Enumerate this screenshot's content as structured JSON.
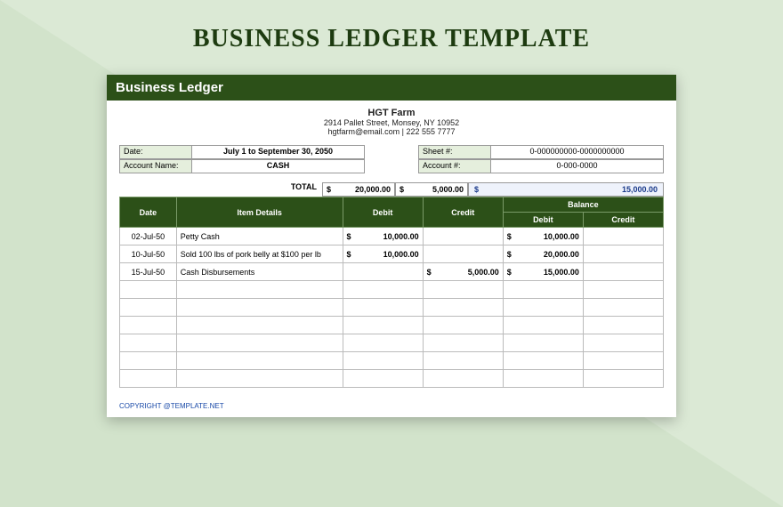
{
  "page_title": "BUSINESS LEDGER TEMPLATE",
  "doc_title": "Business Ledger",
  "org": {
    "name": "HGT Farm",
    "address": "2914 Pallet Street, Monsey, NY 10952",
    "contact": "hgtfarm@email.com | 222 555 7777"
  },
  "meta": {
    "date_label": "Date:",
    "date_value": "July 1 to September 30, 2050",
    "account_name_label": "Account Name:",
    "account_name_value": "CASH",
    "sheet_label": "Sheet #:",
    "sheet_value": "0-000000000-0000000000",
    "account_no_label": "Account #:",
    "account_no_value": "0-000-0000"
  },
  "totals": {
    "label": "TOTAL",
    "debit": "20,000.00",
    "credit": "5,000.00",
    "balance": "15,000.00",
    "currency": "$"
  },
  "headers": {
    "date": "Date",
    "item": "Item Details",
    "debit": "Debit",
    "credit": "Credit",
    "balance": "Balance",
    "bal_debit": "Debit",
    "bal_credit": "Credit"
  },
  "rows": [
    {
      "date": "02-Jul-50",
      "item": "Petty Cash",
      "debit": "10,000.00",
      "credit": "",
      "bal_debit": "10,000.00",
      "bal_credit": ""
    },
    {
      "date": "10-Jul-50",
      "item": "Sold 100 lbs of pork belly at $100 per lb",
      "debit": "10,000.00",
      "credit": "",
      "bal_debit": "20,000.00",
      "bal_credit": ""
    },
    {
      "date": "15-Jul-50",
      "item": "Cash Disbursements",
      "debit": "",
      "credit": "5,000.00",
      "bal_debit": "15,000.00",
      "bal_credit": ""
    },
    {
      "date": "",
      "item": "",
      "debit": "",
      "credit": "",
      "bal_debit": "",
      "bal_credit": ""
    },
    {
      "date": "",
      "item": "",
      "debit": "",
      "credit": "",
      "bal_debit": "",
      "bal_credit": ""
    },
    {
      "date": "",
      "item": "",
      "debit": "",
      "credit": "",
      "bal_debit": "",
      "bal_credit": ""
    },
    {
      "date": "",
      "item": "",
      "debit": "",
      "credit": "",
      "bal_debit": "",
      "bal_credit": ""
    },
    {
      "date": "",
      "item": "",
      "debit": "",
      "credit": "",
      "bal_debit": "",
      "bal_credit": ""
    },
    {
      "date": "",
      "item": "",
      "debit": "",
      "credit": "",
      "bal_debit": "",
      "bal_credit": ""
    }
  ],
  "currency": "$",
  "copyright": "COPYRIGHT @TEMPLATE.NET"
}
